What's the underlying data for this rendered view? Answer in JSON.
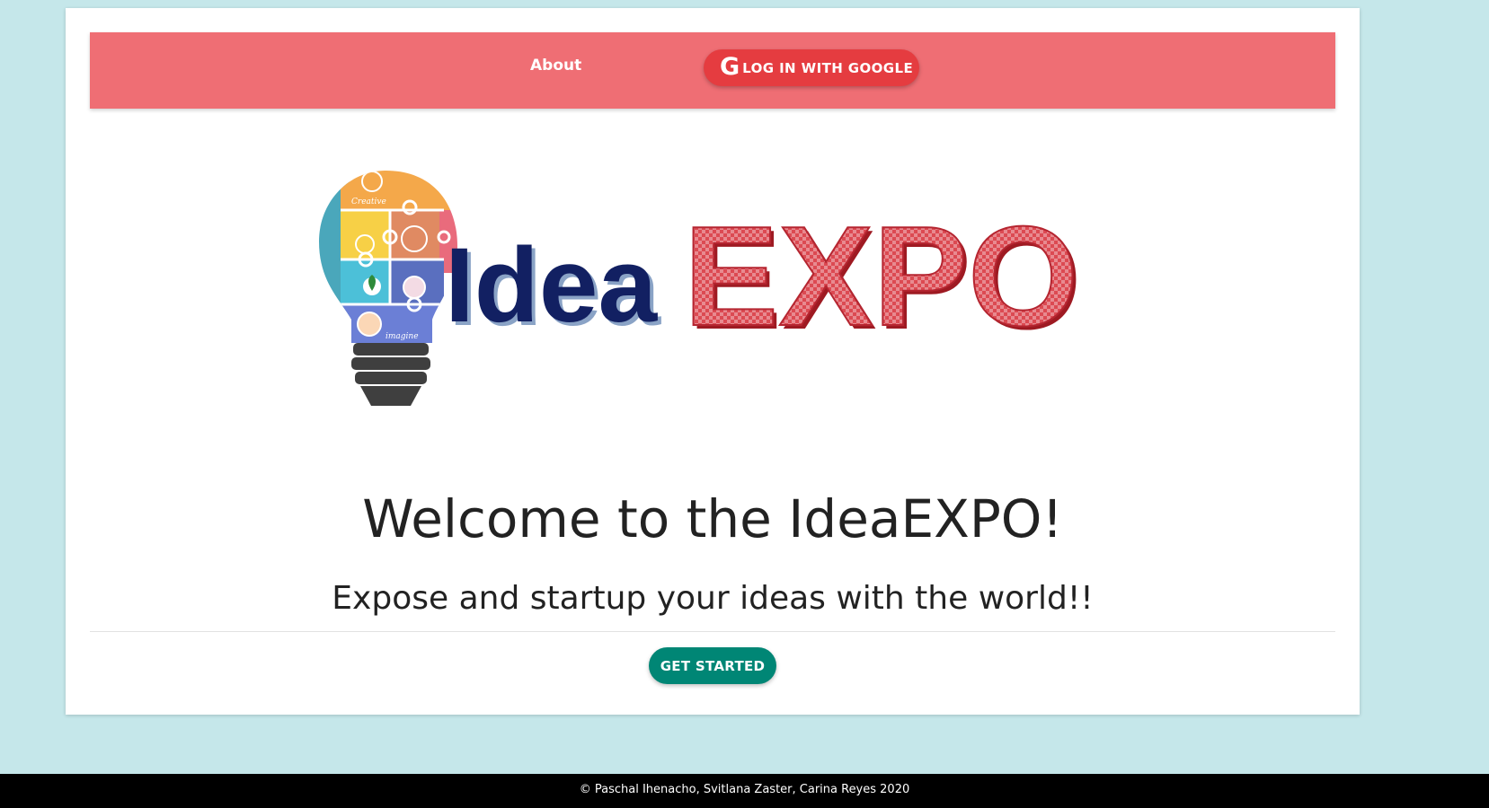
{
  "nav": {
    "about_label": "About",
    "google_icon": "G",
    "google_login_label": "LOG IN WITH GOOGLE"
  },
  "logo": {
    "text_part1": "Idea",
    "text_part2": "EXPO",
    "bulb_label_top": "Creative",
    "bulb_label_bottom": "imagine"
  },
  "hero": {
    "title": "Welcome to the IdeaEXPO!",
    "subtitle": "Expose and startup your ideas with the world!!",
    "cta_label": "GET STARTED"
  },
  "footer": {
    "copyright": "© Paschal Ihenacho, Svitlana Zaster, Carina Reyes 2020"
  },
  "colors": {
    "page_background": "#c5e7ea",
    "navbar": "#ef6e74",
    "google_button": "#e53c40",
    "cta_button": "#008675",
    "logo_idea": "#122062",
    "logo_expo": "#d83a44",
    "footer": "#000000"
  }
}
